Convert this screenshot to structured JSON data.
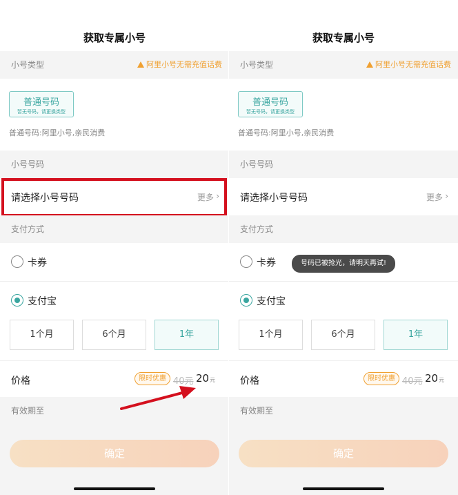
{
  "panels": [
    {
      "title": "获取专属小号",
      "type_section_label": "小号类型",
      "warning": "阿里小号无需充值话费",
      "type_card": {
        "main": "普通号码",
        "sub": "暂无号码，请更换类型"
      },
      "type_desc": "普通号码:阿里小号,亲民消费",
      "number_section_label": "小号号码",
      "choose_label": "请选择小号号码",
      "more_label": "更多",
      "pay_section_label": "支付方式",
      "pay_options": [
        {
          "label": "卡券",
          "selected": false
        },
        {
          "label": "支付宝",
          "selected": true
        }
      ],
      "durations": [
        {
          "label": "1个月",
          "selected": false
        },
        {
          "label": "6个月",
          "selected": false
        },
        {
          "label": "1年",
          "selected": true
        }
      ],
      "price_label": "价格",
      "promo_badge": "限时优惠",
      "old_price": "40元",
      "new_price": "20",
      "currency": "元",
      "expire_label": "有效期至",
      "confirm_label": "确定",
      "highlighted": true
    },
    {
      "title": "获取专属小号",
      "type_section_label": "小号类型",
      "warning": "阿里小号无需充值话费",
      "type_card": {
        "main": "普通号码",
        "sub": "暂无号码，请更换类型"
      },
      "type_desc": "普通号码:阿里小号,亲民消费",
      "number_section_label": "小号号码",
      "choose_label": "请选择小号号码",
      "more_label": "更多",
      "pay_section_label": "支付方式",
      "pay_options": [
        {
          "label": "卡券",
          "selected": false
        },
        {
          "label": "支付宝",
          "selected": true
        }
      ],
      "durations": [
        {
          "label": "1个月",
          "selected": false
        },
        {
          "label": "6个月",
          "selected": false
        },
        {
          "label": "1年",
          "selected": true
        }
      ],
      "price_label": "价格",
      "promo_badge": "限时优惠",
      "old_price": "40元",
      "new_price": "20",
      "currency": "元",
      "expire_label": "有效期至",
      "confirm_label": "确定",
      "toast": "号码已被抢光，请明天再试!"
    }
  ],
  "colors": {
    "accent": "#3aa6a0",
    "warning": "#f0a030",
    "highlight_box": "#d4101e",
    "arrow": "#d4101e"
  }
}
